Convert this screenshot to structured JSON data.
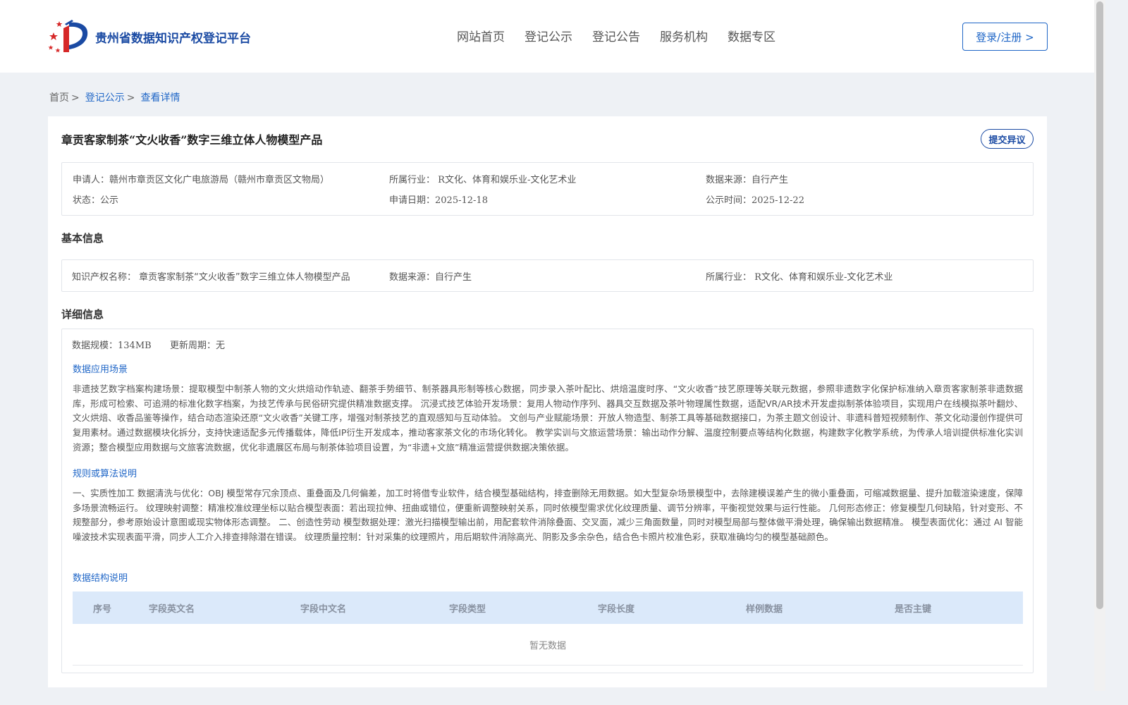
{
  "header": {
    "site_name": "贵州省数据知识产权登记平台",
    "nav": [
      "网站首页",
      "登记公示",
      "登记公告",
      "服务机构",
      "数据专区"
    ],
    "login_label": "登录/注册 >"
  },
  "breadcrumb": {
    "home": "首页",
    "level1": "登记公示",
    "current": "查看详情",
    "separator": ">"
  },
  "record": {
    "title": "章贡客家制茶“文火收香”数字三维立体人物模型产品",
    "objection_label": "提交异议",
    "summary": {
      "applicant_label": "申请人：",
      "applicant": "赣州市章贡区文化广电旅游局（赣州市章贡区文物局）",
      "industry_label": "所属行业：",
      "industry": "R文化、体育和娱乐业-文化艺术业",
      "source_label": "数据来源：",
      "source": "自行产生",
      "status_label": "状态：",
      "status": "公示",
      "apply_date_label": "申请日期：",
      "apply_date": "2025-12-18",
      "publish_date_label": "公示时间：",
      "publish_date": "2025-12-22"
    },
    "basic": {
      "section_title": "基本信息",
      "ip_name_label": "知识产权名称：",
      "ip_name": "章贡客家制茶“文火收香”数字三维立体人物模型产品",
      "source_label": "数据来源：",
      "source": "自行产生",
      "industry_label": "所属行业：",
      "industry": "R文化、体育和娱乐业-文化艺术业"
    },
    "detail": {
      "section_title": "详细信息",
      "scale_label": "数据规模：",
      "scale": "134MB",
      "cycle_label": "更新周期：",
      "cycle": "无",
      "scenario_title": "数据应用场景",
      "scenario_text": "非遗技艺数字档案构建场景：提取模型中制茶人物的文火烘焙动作轨迹、翻茶手势细节、制茶器具形制等核心数据，同步录入茶叶配比、烘焙温度时序、“文火收香”技艺原理等关联元数据，参照非遗数字化保护标准纳入章贡客家制茶非遗数据库，形成可检索、可追溯的标准化数字档案，为技艺传承与民俗研究提供精准数据支撑。 沉浸式技艺体验开发场景：复用人物动作序列、器具交互数据及茶叶物理属性数据，适配VR/AR技术开发虚拟制茶体验项目，实现用户在线模拟茶叶翻炒、文火烘焙、收香品鉴等操作，结合动态渲染还原“文火收香”关键工序，增强对制茶技艺的直观感知与互动体验。 文创与产业赋能场景：开放人物造型、制茶工具等基础数据接口，为茶主题文创设计、非遗科普短视频制作、茶文化动漫创作提供可复用素材。通过数据模块化拆分，支持快速适配多元传播载体，降低IP衍生开发成本，推动客家茶文化的市场化转化。 教学实训与文旅运营场景：输出动作分解、温度控制要点等结构化数据，构建数字化教学系统，为传承人培训提供标准化实训资源；整合模型应用数据与文旅客流数据，优化非遗展区布局与制茶体验项目设置，为“非遗+文旅”精准运营提供数据决策依据。",
      "rules_title": "规则或算法说明",
      "rules_text": "一、实质性加工 数据清洗与优化：OBJ 模型常存冗余顶点、重叠面及几何偏差，加工时将借专业软件，结合模型基础结构，排查删除无用数据。如大型复杂场景模型中，去除建模误差产生的微小重叠面，可缩减数据量、提升加载渲染速度，保障多场景流畅运行。 纹理映射调整：精准校准纹理坐标以贴合模型表面：若出现拉伸、扭曲或错位，便重新调整映射关系，同时依模型需求优化纹理质量、调节分辨率，平衡视觉效果与运行性能。 几何形态修正：修复模型几何缺陷，针对变形、不规整部分，参考原始设计意图或现实物体形态调整。 二、创造性劳动 模型数据处理：激光扫描模型输出前，用配套软件消除叠面、交叉面，减少三角面数量，同时对模型局部与整体做平滑处理，确保输出数据精准。 模型表面优化：通过 AI 智能噪波技术实现表面平滑，同步人工介入排查排除潜在错误。 纹理质量控制：针对采集的纹理照片，用后期软件消除高光、阴影及多余杂色，结合色卡照片校准色彩，获取准确均匀的模型基础颜色。",
      "structure_title": "数据结构说明",
      "table_headers": [
        "序号",
        "字段英文名",
        "字段中文名",
        "字段类型",
        "字段长度",
        "样例数据",
        "是否主键"
      ],
      "empty_text": "暂无数据"
    }
  },
  "colors": {
    "brand": "#1a4aa3",
    "link": "#1f66c7",
    "table_head_bg": "#dbe9fa",
    "logo_red": "#d62828"
  },
  "icons": {
    "logo": "guizhou-platform-logo-icon"
  }
}
